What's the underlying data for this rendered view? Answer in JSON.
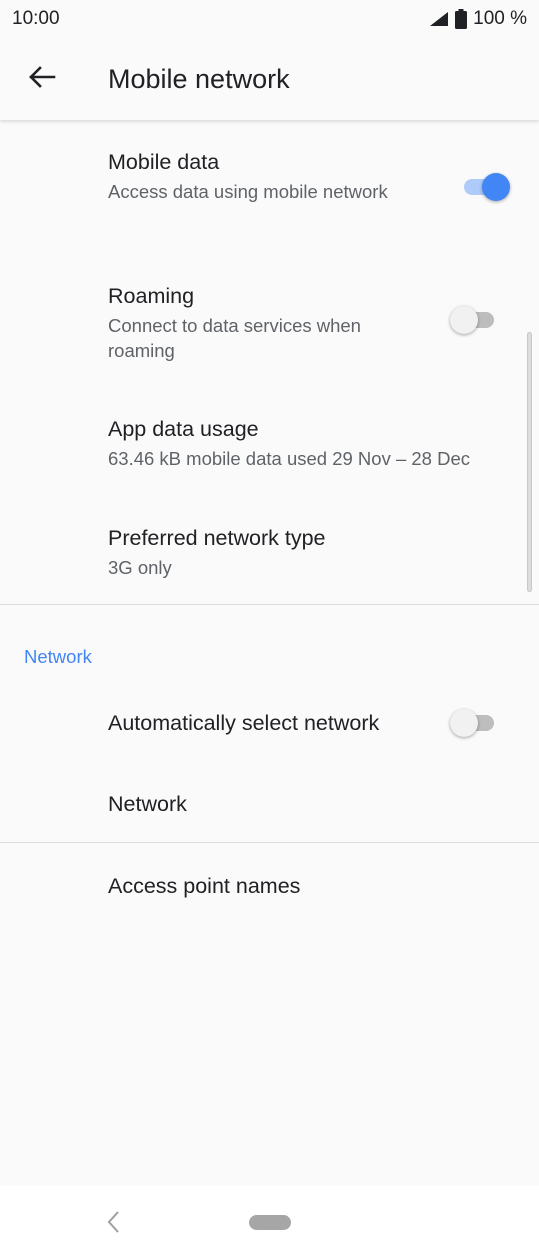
{
  "status_bar": {
    "time": "10:00",
    "battery": "100 %"
  },
  "app_bar": {
    "title": "Mobile network"
  },
  "items": {
    "mobile_data": {
      "title": "Mobile data",
      "subtitle": "Access data using mobile network",
      "enabled": true
    },
    "roaming": {
      "title": "Roaming",
      "subtitle": "Connect to data services when roaming",
      "enabled": false
    },
    "app_data_usage": {
      "title": "App data usage",
      "subtitle": "63.46 kB mobile data used 29 Nov – 28 Dec"
    },
    "preferred_network_type": {
      "title": "Preferred network type",
      "subtitle": "3G only"
    }
  },
  "network_section": {
    "header": "Network",
    "auto_select": {
      "title": "Automatically select network",
      "enabled": false
    },
    "network": {
      "title": "Network"
    }
  },
  "access_point_names": {
    "title": "Access point names"
  },
  "colors": {
    "accent": "#4285f4",
    "background": "#fafafa"
  }
}
